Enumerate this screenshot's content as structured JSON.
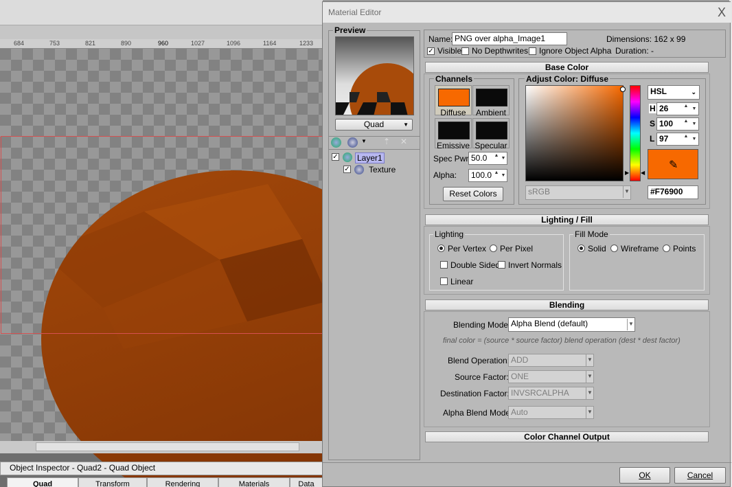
{
  "viewport": {
    "ruler_ticks": [
      "684",
      "753",
      "821",
      "890",
      "960",
      "1027",
      "1096",
      "1164",
      "1233"
    ],
    "inspector_title": "Object Inspector - Quad2 - Quad Object",
    "tabs": [
      "Quad",
      "Transform",
      "Rendering",
      "Materials",
      "Data"
    ]
  },
  "dialog": {
    "title": "Material Editor",
    "close_glyph": "X",
    "preview": {
      "label": "Preview",
      "dropdown": "Quad"
    },
    "layers": [
      {
        "label": "Layer1",
        "checked": true
      },
      {
        "label": "Texture",
        "checked": true
      }
    ],
    "name_label": "Name:",
    "name_value": "PNG over alpha_Image1",
    "dimensions": "Dimensions: 162 x 99",
    "visible_label": "Visible",
    "no_depthwrites_label": "No Depthwrites",
    "ignore_alpha_label": "Ignore Object Alpha",
    "duration": "Duration: -",
    "base_color": {
      "header": "Base Color",
      "channels_label": "Channels",
      "channels": [
        {
          "label": "Diffuse",
          "color": "#F76900"
        },
        {
          "label": "Ambient",
          "color": "#0a0a0a"
        },
        {
          "label": "Emissive",
          "color": "#0a0a0a"
        },
        {
          "label": "Specular",
          "color": "#0a0a0a"
        }
      ],
      "spec_pwr_label": "Spec Pwr:",
      "spec_pwr": "50.0",
      "alpha_label": "Alpha:",
      "alpha": "100.0",
      "reset_label": "Reset Colors",
      "adjust_label": "Adjust Color: Diffuse",
      "mode": "HSL",
      "h_label": "H",
      "h": "26",
      "s_label": "S",
      "s": "100",
      "l_label": "L",
      "l": "97",
      "colorspace": "sRGB",
      "hex": "#F76900",
      "current_color": "#F76900"
    },
    "lighting": {
      "header": "Lighting / Fill",
      "lighting_label": "Lighting",
      "per_vertex": "Per Vertex",
      "per_pixel": "Per Pixel",
      "double_sided": "Double Sided",
      "invert_normals": "Invert Normals",
      "linear": "Linear",
      "fill_label": "Fill Mode",
      "solid": "Solid",
      "wireframe": "Wireframe",
      "points": "Points"
    },
    "blending": {
      "header": "Blending",
      "mode_label": "Blending Mode:",
      "mode": "Alpha Blend (default)",
      "formula": "final color = (source * source factor) blend operation (dest * dest factor)",
      "op_label": "Blend Operation:",
      "op": "ADD",
      "src_label": "Source Factor:",
      "src": "ONE",
      "dst_label": "Destination Factor:",
      "dst": "INVSRCALPHA",
      "abm_label": "Alpha Blend Mode:",
      "abm": "Auto"
    },
    "color_channel_output": "Color Channel Output",
    "ok": "OK",
    "cancel": "Cancel"
  }
}
